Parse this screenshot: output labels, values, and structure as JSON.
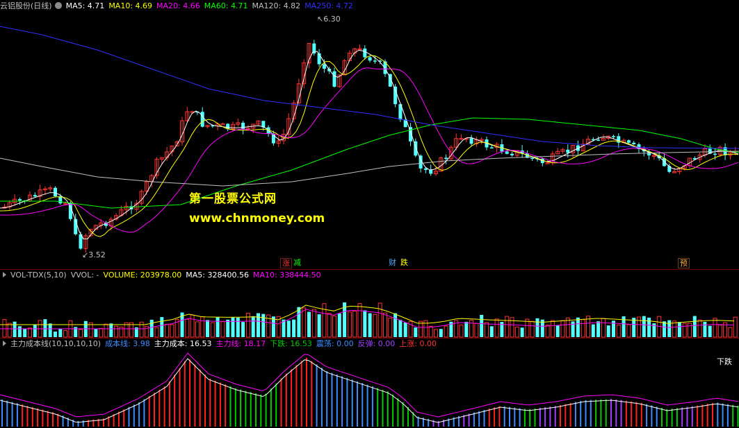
{
  "main_panel": {
    "stock_label": "云铝股份(日线)",
    "ma5": "MA5: 4.71",
    "ma10": "MA10: 4.69",
    "ma20": "MA20: 4.66",
    "ma60": "MA60: 4.71",
    "ma120": "MA120: 4.82",
    "ma250": "MA250: 4.72",
    "high_marker": "6.30",
    "low_marker": "3.52",
    "watermark_title": "第一股票公式网",
    "watermark_url": "www.chnmoney.com",
    "event_tags": [
      {
        "a": "涨",
        "b": "减"
      },
      {
        "a": "财",
        "b": "跌"
      },
      {
        "a": "预"
      }
    ]
  },
  "volume_panel": {
    "indicator": "VOL-TDX(5,10)",
    "vvol": "VVOL: -",
    "volume": "VOLUME: 203978.00",
    "ma5": "MA5: 328400.56",
    "ma10": "MA10: 338444.50"
  },
  "cost_panel": {
    "indicator": "主力成本线(10,10,10,10)",
    "cost_line": "成本线: 3.98",
    "main_cost": "主力成本: 16.53",
    "main_line": "主力线: 18.17",
    "fall": "下跌: 16.53",
    "oscillation": "震荡: 0.00",
    "rebound": "反弹: 0.00",
    "rise": "上涨: 0.00",
    "status": "下跌"
  },
  "colors": {
    "up": "#ff3232",
    "down": "#54ffff",
    "ma5": "#ffffff",
    "ma10": "#ffff00",
    "ma20": "#ff00ff",
    "ma60": "#00ff00",
    "ma120": "#c0c0c0",
    "ma250": "#3030ff"
  }
}
